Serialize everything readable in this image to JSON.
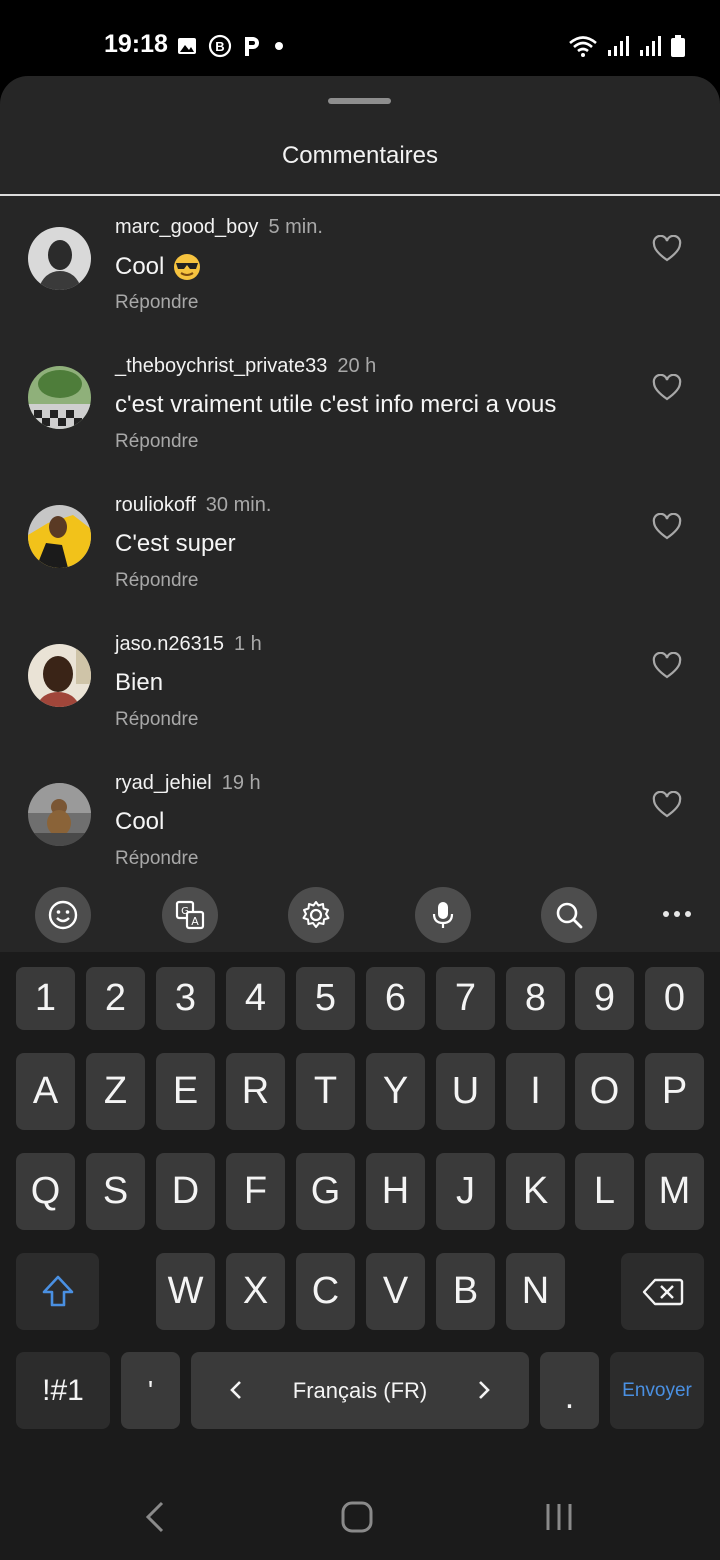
{
  "status_bar": {
    "time": "19:18",
    "icons_left": [
      "image-icon",
      "b-badge-icon",
      "p-app-icon",
      "dot-icon"
    ],
    "icons_right": [
      "wifi-icon",
      "signal-icon",
      "signal-icon",
      "battery-icon"
    ]
  },
  "sheet": {
    "title": "Commentaires"
  },
  "comments": [
    {
      "username": "marc_good_boy",
      "time": "5 min.",
      "text": "Cool",
      "emoji": "sunglasses-emoji",
      "reply": "Répondre"
    },
    {
      "username": "_theboychrist_private33",
      "time": "20 h",
      "text": "c'est vraiment utile c'est info merci a vous",
      "reply": "Répondre"
    },
    {
      "username": "rouliokoff",
      "time": "30 min.",
      "text": "C'est super",
      "reply": "Répondre"
    },
    {
      "username": "jaso.n26315",
      "time": "1 h",
      "text": "Bien",
      "reply": "Répondre"
    },
    {
      "username": "ryad_jehiel",
      "time": "19 h",
      "text": "Cool",
      "reply": "Répondre"
    }
  ],
  "keyboard": {
    "toolbar": [
      "emoji-icon",
      "translate-icon",
      "settings-icon",
      "microphone-icon",
      "search-icon",
      "more-icon"
    ],
    "row_numbers": [
      "1",
      "2",
      "3",
      "4",
      "5",
      "6",
      "7",
      "8",
      "9",
      "0"
    ],
    "row1": [
      "A",
      "Z",
      "E",
      "R",
      "T",
      "Y",
      "U",
      "I",
      "O",
      "P"
    ],
    "row2": [
      "Q",
      "S",
      "D",
      "F",
      "G",
      "H",
      "J",
      "K",
      "L",
      "M"
    ],
    "row3": [
      "W",
      "X",
      "C",
      "V",
      "B",
      "N"
    ],
    "symbols_label": "!#1",
    "apostrophe": "'",
    "space_label": "Français (FR)",
    "period": ".",
    "send_label": "Envoyer",
    "accent_color": "#4a90e2"
  },
  "nav_bar": [
    "back-icon",
    "home-icon",
    "recents-icon"
  ]
}
